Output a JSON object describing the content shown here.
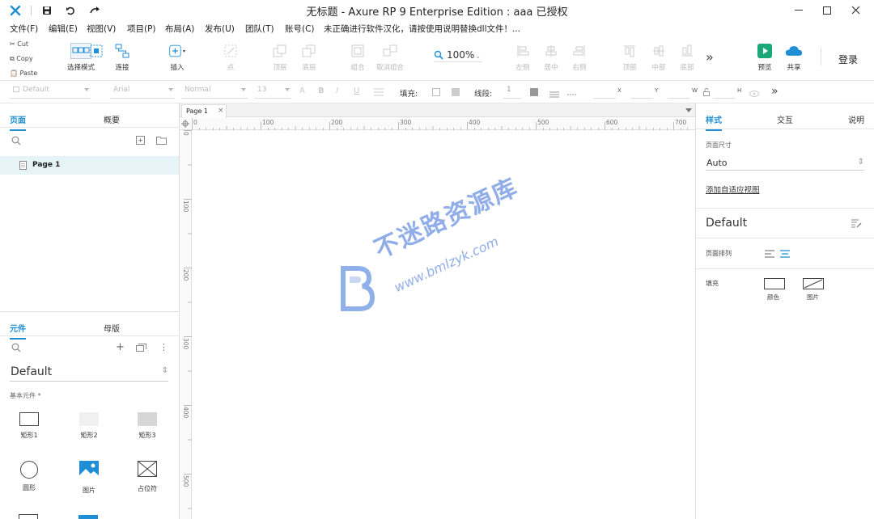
{
  "window": {
    "title": "无标题 - Axure RP 9 Enterprise Edition : aaa 已授权"
  },
  "menu": [
    "文件(F)",
    "编辑(E)",
    "视图(V)",
    "项目(P)",
    "布局(A)",
    "发布(U)",
    "团队(T)",
    "账号(C)",
    "未正确进行软件汉化，请按使用说明替换dll文件！..."
  ],
  "clipboard": {
    "cut": "Cut",
    "copy": "Copy",
    "paste": "Paste"
  },
  "toolbar": {
    "select_mode": "选择模式",
    "connect": "连接",
    "insert": "插入",
    "point": "点",
    "top": "顶层",
    "bottom": "底层",
    "group": "组合",
    "ungroup": "取消组合",
    "zoom": "100%",
    "align_left": "左侧",
    "align_center": "居中",
    "align_right": "右侧",
    "align_top": "顶部",
    "align_middle": "中部",
    "align_bottom": "底部",
    "more": "»",
    "preview": "预览",
    "share": "共享",
    "login": "登录"
  },
  "format": {
    "style": "Default",
    "font": "Arial",
    "weight": "Normal",
    "size": "13",
    "fill_label": "填充:",
    "stroke_label": "线段:",
    "stroke_value": "1",
    "x_label": "X",
    "y_label": "Y",
    "w_label": "W",
    "h_label": "H"
  },
  "left_panel": {
    "tabs_top": [
      "页面",
      "概要"
    ],
    "page_item": "Page 1",
    "tabs_bottom": [
      "元件",
      "母版"
    ],
    "library": "Default",
    "category": "基本元件 *",
    "shapes": [
      "矩形1",
      "矩形2",
      "矩形3",
      "圆形",
      "图片",
      "占位符"
    ]
  },
  "canvas": {
    "tab": "Page 1",
    "ruler_h": [
      "0",
      "100",
      "200",
      "300",
      "400",
      "500",
      "600",
      "700"
    ],
    "ruler_v": [
      "0",
      "100",
      "200",
      "300",
      "400",
      "500"
    ],
    "watermark_cn": "不迷路资源库",
    "watermark_url": "www.bmlzyk.com"
  },
  "right_panel": {
    "tabs": [
      "样式",
      "交互",
      "说明"
    ],
    "page_size_label": "页面尺寸",
    "page_size_value": "Auto",
    "adaptive_link": "添加自适应视图",
    "style_name": "Default",
    "page_align_label": "页面排列",
    "fill_label": "填充",
    "fill_color": "颜色",
    "fill_image": "图片"
  },
  "colors": {
    "accent": "#1f8ed4",
    "preview": "#1aa87a",
    "share": "#1f8ed4",
    "logo": "#1f8ed4"
  }
}
